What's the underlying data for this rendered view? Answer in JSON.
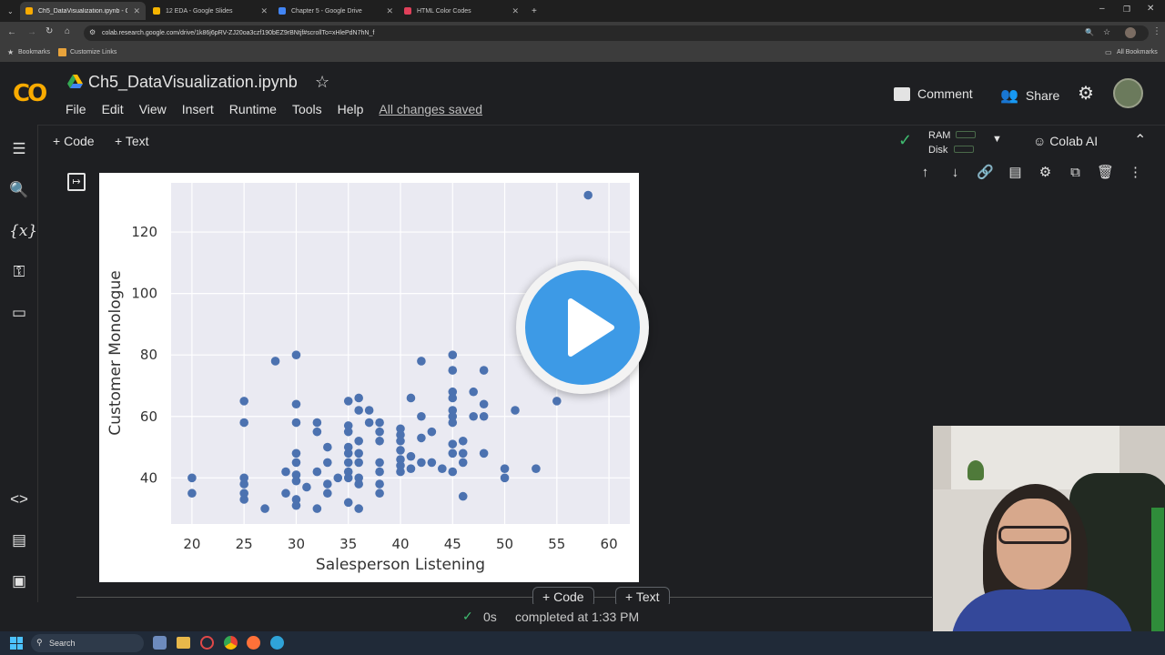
{
  "browser": {
    "tabs": [
      {
        "label": "Ch5_DataVisualization.ipynb - Co",
        "color": "#f9ab00",
        "active": true
      },
      {
        "label": "12 EDA - Google Slides",
        "color": "#f4b400",
        "active": false
      },
      {
        "label": "Chapter 5 - Google Drive",
        "color": "#4285f4",
        "active": false
      },
      {
        "label": "HTML Color Codes",
        "color": "#e0405a",
        "active": false
      }
    ],
    "url": "colab.research.google.com/drive/1k86j6pRV-ZJ20oa3czf190bEZ9rBNtjf#scrollTo=xHlePdN7hN_f",
    "bookmarks_label": "Bookmarks",
    "customize_label": "Customize Links",
    "all_bookmarks_label": "All Bookmarks"
  },
  "colab": {
    "logo": "CO",
    "notebook_title": "Ch5_DataVisualization.ipynb",
    "menu": [
      "File",
      "Edit",
      "View",
      "Insert",
      "Runtime",
      "Tools",
      "Help"
    ],
    "saved_status": "All changes saved",
    "comment_label": "Comment",
    "share_label": "Share",
    "add_code_label": "Code",
    "add_text_label": "Text",
    "ram_label": "RAM",
    "disk_label": "Disk",
    "colab_ai_label": "Colab AI",
    "status_time": "0s",
    "status_text": "completed at 1:33 PM"
  },
  "taskbar": {
    "search_label": "Search"
  },
  "chart_data": {
    "type": "scatter",
    "xlabel": "Salesperson Listening",
    "ylabel": "Customer Monologue",
    "xlim": [
      18,
      62
    ],
    "ylim": [
      25,
      136
    ],
    "xticks": [
      20,
      25,
      30,
      35,
      40,
      45,
      50,
      55,
      60
    ],
    "yticks": [
      40,
      60,
      80,
      100,
      120
    ],
    "grid": true,
    "point_color": "#4c72b0",
    "background": "#eaeaf2",
    "points": [
      [
        20,
        40
      ],
      [
        20,
        35
      ],
      [
        25,
        65
      ],
      [
        25,
        58
      ],
      [
        25,
        40
      ],
      [
        25,
        38
      ],
      [
        25,
        35
      ],
      [
        25,
        33
      ],
      [
        27,
        30
      ],
      [
        28,
        78
      ],
      [
        29,
        42
      ],
      [
        29,
        35
      ],
      [
        30,
        80
      ],
      [
        30,
        64
      ],
      [
        30,
        58
      ],
      [
        30,
        48
      ],
      [
        30,
        45
      ],
      [
        30,
        41
      ],
      [
        30,
        39
      ],
      [
        30,
        33
      ],
      [
        30,
        31
      ],
      [
        31,
        37
      ],
      [
        32,
        58
      ],
      [
        32,
        55
      ],
      [
        32,
        42
      ],
      [
        32,
        30
      ],
      [
        33,
        50
      ],
      [
        33,
        45
      ],
      [
        33,
        38
      ],
      [
        33,
        35
      ],
      [
        34,
        40
      ],
      [
        35,
        65
      ],
      [
        35,
        57
      ],
      [
        35,
        55
      ],
      [
        35,
        50
      ],
      [
        35,
        48
      ],
      [
        35,
        45
      ],
      [
        35,
        42
      ],
      [
        35,
        40
      ],
      [
        35,
        32
      ],
      [
        36,
        66
      ],
      [
        36,
        62
      ],
      [
        36,
        52
      ],
      [
        36,
        48
      ],
      [
        36,
        45
      ],
      [
        36,
        40
      ],
      [
        36,
        38
      ],
      [
        36,
        30
      ],
      [
        37,
        62
      ],
      [
        37,
        58
      ],
      [
        38,
        58
      ],
      [
        38,
        55
      ],
      [
        38,
        52
      ],
      [
        38,
        45
      ],
      [
        38,
        42
      ],
      [
        38,
        38
      ],
      [
        38,
        35
      ],
      [
        40,
        56
      ],
      [
        40,
        54
      ],
      [
        40,
        52
      ],
      [
        40,
        49
      ],
      [
        40,
        46
      ],
      [
        40,
        44
      ],
      [
        40,
        42
      ],
      [
        41,
        66
      ],
      [
        41,
        47
      ],
      [
        41,
        43
      ],
      [
        42,
        78
      ],
      [
        42,
        60
      ],
      [
        42,
        53
      ],
      [
        42,
        45
      ],
      [
        43,
        55
      ],
      [
        43,
        45
      ],
      [
        44,
        43
      ],
      [
        45,
        80
      ],
      [
        45,
        75
      ],
      [
        45,
        68
      ],
      [
        45,
        66
      ],
      [
        45,
        62
      ],
      [
        45,
        60
      ],
      [
        45,
        58
      ],
      [
        45,
        51
      ],
      [
        45,
        48
      ],
      [
        45,
        42
      ],
      [
        46,
        52
      ],
      [
        46,
        48
      ],
      [
        46,
        45
      ],
      [
        46,
        34
      ],
      [
        47,
        68
      ],
      [
        47,
        60
      ],
      [
        48,
        75
      ],
      [
        48,
        64
      ],
      [
        48,
        60
      ],
      [
        48,
        48
      ],
      [
        50,
        43
      ],
      [
        50,
        40
      ],
      [
        51,
        62
      ],
      [
        53,
        43
      ],
      [
        55,
        65
      ],
      [
        58,
        132
      ]
    ]
  }
}
